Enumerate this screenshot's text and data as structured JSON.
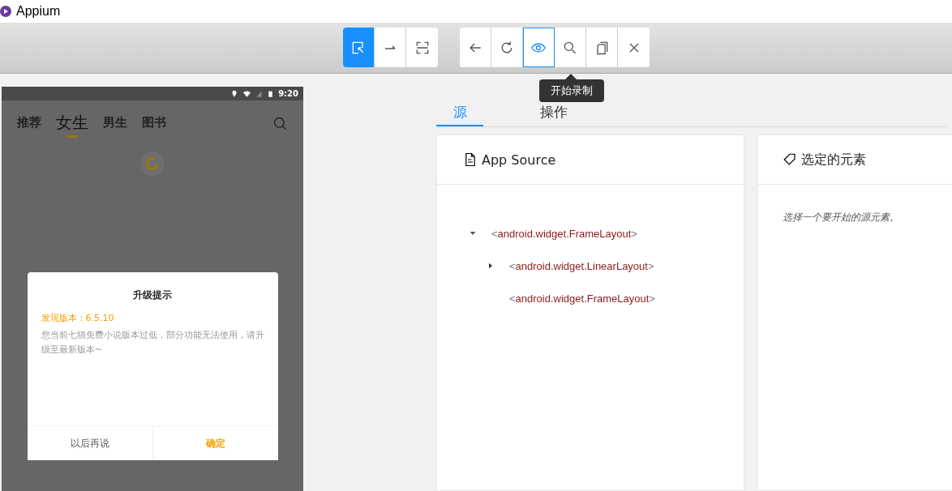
{
  "window": {
    "title": "Appium"
  },
  "toolbar": {
    "groups": [
      {
        "buttons": [
          {
            "kind": "select",
            "selected": true
          },
          {
            "kind": "swipe",
            "selected": false
          },
          {
            "kind": "tap",
            "selected": false
          }
        ]
      },
      {
        "buttons": [
          {
            "kind": "back",
            "selected": false
          },
          {
            "kind": "refresh",
            "selected": false
          },
          {
            "kind": "eye",
            "selected": true
          },
          {
            "kind": "search",
            "selected": false
          },
          {
            "kind": "copy",
            "selected": false
          },
          {
            "kind": "close",
            "selected": false
          }
        ]
      }
    ]
  },
  "tooltip": {
    "text": "开始录制"
  },
  "device": {
    "status_bar": {
      "time": "9:20"
    },
    "tabs": [
      {
        "label": "推荐",
        "selected": false
      },
      {
        "label": "女生",
        "selected": true
      },
      {
        "label": "男生",
        "selected": false
      },
      {
        "label": "图书",
        "selected": false
      }
    ],
    "dialog": {
      "title": "升级提示",
      "version": "发现版本：6.5.10",
      "message": "您当前七猫免费小说版本过低，部分功能无法使用，请升级至最新版本~",
      "buttons": [
        {
          "label": "以后再说",
          "kind": "secondary"
        },
        {
          "label": "确定",
          "kind": "primary"
        }
      ]
    }
  },
  "inspector": {
    "tabs": [
      {
        "label": "源",
        "selected": true
      },
      {
        "label": "操作",
        "selected": false
      }
    ],
    "source_panel": {
      "title": "App Source",
      "tree": [
        {
          "tag": "<android.widget.FrameLayout>",
          "expanded": true,
          "children": [
            {
              "tag": "<android.widget.LinearLayout>",
              "expanded": false
            },
            {
              "tag": "<android.widget.FrameLayout>"
            }
          ]
        }
      ]
    },
    "element_panel": {
      "title": "选定的元素",
      "hint": "选择一个要开始的源元素。"
    }
  }
}
